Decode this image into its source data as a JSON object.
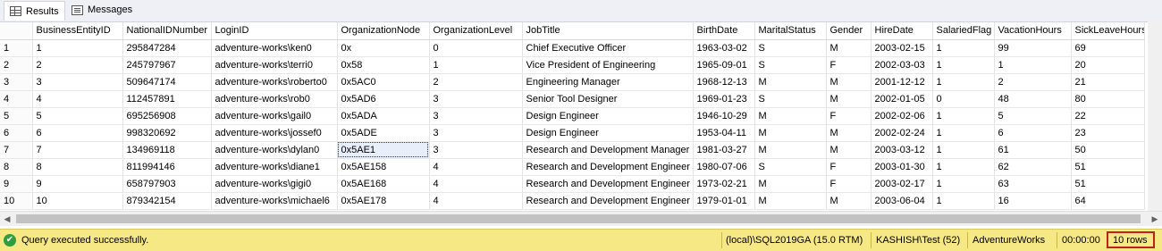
{
  "tabs": {
    "results": "Results",
    "messages": "Messages"
  },
  "columns": [
    "",
    "BusinessEntityID",
    "NationalIDNumber",
    "LoginID",
    "OrganizationNode",
    "OrganizationLevel",
    "JobTitle",
    "BirthDate",
    "MaritalStatus",
    "Gender",
    "HireDate",
    "SalariedFlag",
    "VacationHours",
    "SickLeaveHours"
  ],
  "rows": [
    [
      "1",
      "1",
      "295847284",
      "adventure-works\\ken0",
      "0x",
      "0",
      "Chief Executive Officer",
      "1963-03-02",
      "S",
      "M",
      "2003-02-15",
      "1",
      "99",
      "69"
    ],
    [
      "2",
      "2",
      "245797967",
      "adventure-works\\terri0",
      "0x58",
      "1",
      "Vice President of Engineering",
      "1965-09-01",
      "S",
      "F",
      "2002-03-03",
      "1",
      "1",
      "20"
    ],
    [
      "3",
      "3",
      "509647174",
      "adventure-works\\roberto0",
      "0x5AC0",
      "2",
      "Engineering Manager",
      "1968-12-13",
      "M",
      "M",
      "2001-12-12",
      "1",
      "2",
      "21"
    ],
    [
      "4",
      "4",
      "112457891",
      "adventure-works\\rob0",
      "0x5AD6",
      "3",
      "Senior Tool Designer",
      "1969-01-23",
      "S",
      "M",
      "2002-01-05",
      "0",
      "48",
      "80"
    ],
    [
      "5",
      "5",
      "695256908",
      "adventure-works\\gail0",
      "0x5ADA",
      "3",
      "Design Engineer",
      "1946-10-29",
      "M",
      "F",
      "2002-02-06",
      "1",
      "5",
      "22"
    ],
    [
      "6",
      "6",
      "998320692",
      "adventure-works\\jossef0",
      "0x5ADE",
      "3",
      "Design Engineer",
      "1953-04-11",
      "M",
      "M",
      "2002-02-24",
      "1",
      "6",
      "23"
    ],
    [
      "7",
      "7",
      "134969118",
      "adventure-works\\dylan0",
      "0x5AE1",
      "3",
      "Research and Development Manager",
      "1981-03-27",
      "M",
      "M",
      "2003-03-12",
      "1",
      "61",
      "50"
    ],
    [
      "8",
      "8",
      "811994146",
      "adventure-works\\diane1",
      "0x5AE158",
      "4",
      "Research and Development Engineer",
      "1980-07-06",
      "S",
      "F",
      "2003-01-30",
      "1",
      "62",
      "51"
    ],
    [
      "9",
      "9",
      "658797903",
      "adventure-works\\gigi0",
      "0x5AE168",
      "4",
      "Research and Development Engineer",
      "1973-02-21",
      "M",
      "F",
      "2003-02-17",
      "1",
      "63",
      "51"
    ],
    [
      "10",
      "10",
      "879342154",
      "adventure-works\\michael6",
      "0x5AE178",
      "4",
      "Research and Development Engineer",
      "1979-01-01",
      "M",
      "M",
      "2003-06-04",
      "1",
      "16",
      "64"
    ]
  ],
  "status": {
    "message": "Query executed successfully.",
    "server": "(local)\\SQL2019GA (15.0 RTM)",
    "user": "KASHISH\\Test (52)",
    "database": "AdventureWorks",
    "elapsed": "00:00:00",
    "row_count": "10 rows"
  },
  "icons": {
    "results_tab": "grid-icon",
    "messages_tab": "messages-icon",
    "status_ok": "check-circle-icon",
    "scroll_left": "scroll-left-arrow-icon",
    "scroll_right": "scroll-right-arrow-icon"
  },
  "colors": {
    "status_bar": "#f5e885",
    "success": "#2e9e3e",
    "highlight_box": "#c0201c"
  }
}
